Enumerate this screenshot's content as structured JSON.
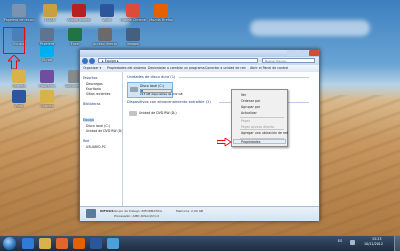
{
  "desktop": {
    "icons": [
      {
        "label": "Equipo",
        "color": "#4a7fb8"
      },
      {
        "label": "Papelera de reciclaje",
        "color": "#7a93b0"
      },
      {
        "label": "FLASH",
        "color": "#c8a040"
      },
      {
        "label": "Adobe Reader",
        "color": "#b52020"
      },
      {
        "label": "Word",
        "color": "#2b579a"
      },
      {
        "label": "Google Chrome",
        "color": "#dd4b39"
      },
      {
        "label": "Mozilla Firefox",
        "color": "#e66000"
      },
      {
        "label": "Skype",
        "color": "#00aff0"
      },
      {
        "label": "Excel",
        "color": "#217346"
      },
      {
        "label": "Acceso directo",
        "color": "#6a6a6a"
      },
      {
        "label": "imagen",
        "color": "#445f80"
      },
      {
        "label": "Papelera",
        "color": "#5d7590"
      },
      {
        "label": "Carpeta",
        "color": "#d8b24a"
      },
      {
        "label": "Programa",
        "color": "#6f4ea0"
      },
      {
        "label": "Documento",
        "color": "#8a8a8a"
      },
      {
        "label": "Word",
        "color": "#2b579a"
      },
      {
        "label": "Carpeta",
        "color": "#d8b24a"
      }
    ]
  },
  "explorer": {
    "address": "▸ Equipo ▸",
    "search_placeholder": "Buscar Equipo",
    "toolbar": {
      "organize": "Organizar ▾",
      "properties": "Propiedades del sistema",
      "uninstall": "Desinstalar o cambiar un programa",
      "map_drive": "Conectar a unidad de red",
      "control_panel": "Abrir el Panel de control"
    },
    "nav": {
      "favorites": "Favoritos",
      "downloads": "Descargas",
      "desktop": "Escritorio",
      "recent": "Sitios recientes",
      "libraries": "Bibliotecas",
      "computer": "Equipo",
      "local_disk": "Disco local (C:)",
      "dvd": "Unidad de DVD RW (D:)",
      "network": "Red",
      "network_pc": "USUARIO-PC"
    },
    "groups": {
      "hard_disks": "Unidades de disco duro (1)",
      "removable": "Dispositivos con almacenamiento extraíble (1)"
    },
    "drive": {
      "name": "Disco local (C:)",
      "free": "213 GB disponibles de 232 GB",
      "used_fraction": 0.08
    },
    "dvd_drive": "Unidad de DVD RW (D:)",
    "details": {
      "name": "INFOSIS",
      "workgroup": "Grupo de trabajo: INFORMATICA",
      "processor": "Procesador: AMD Athlon(tm) II",
      "memory": "Memoria: 2,00 GB"
    }
  },
  "context_menu": {
    "items": [
      {
        "label": "Ver",
        "disabled": false
      },
      {
        "label": "Ordenar por",
        "disabled": false
      },
      {
        "label": "Agrupar por",
        "disabled": false
      },
      {
        "label": "Actualizar",
        "disabled": false
      },
      {
        "label": "Pegar",
        "disabled": true
      },
      {
        "label": "Pegar acceso directo",
        "disabled": true
      },
      {
        "label": "Agregar una ubicación de red",
        "disabled": false
      },
      {
        "label": "Propiedades",
        "disabled": false
      }
    ]
  },
  "taskbar": {
    "lang": "ES",
    "time": "15:23",
    "date": "10/11/2012",
    "apps": [
      {
        "name": "internet-explorer",
        "color": "#2f7bd6"
      },
      {
        "name": "windows-explorer",
        "color": "#d8b24a"
      },
      {
        "name": "media-player",
        "color": "#e0672b"
      },
      {
        "name": "firefox",
        "color": "#e66000"
      },
      {
        "name": "word",
        "color": "#2b579a"
      },
      {
        "name": "paint",
        "color": "#4aa0d8"
      }
    ]
  },
  "colors": {
    "highlight_red": "#e01010",
    "window_frame": "#cfe0f2",
    "selection_blue": "#cde6f7"
  }
}
